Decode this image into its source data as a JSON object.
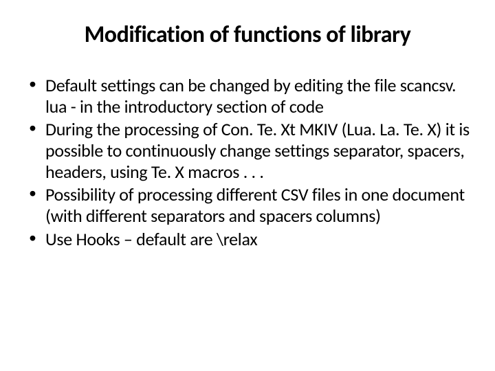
{
  "slide": {
    "title": "Modification of functions of library",
    "bullets": [
      "Default settings can be changed by editing the file scancsv. lua - in the introductory section of code",
      "During the processing of Con. Te. Xt MKIV (Lua. La. Te. X) it is possible to continuously change settings separator, spacers, headers, using Te. X macros . . .",
      "Possibility of processing different CSV files in one document (with different separators and spacers columns)",
      "Use Hooks – default are \\relax"
    ]
  }
}
